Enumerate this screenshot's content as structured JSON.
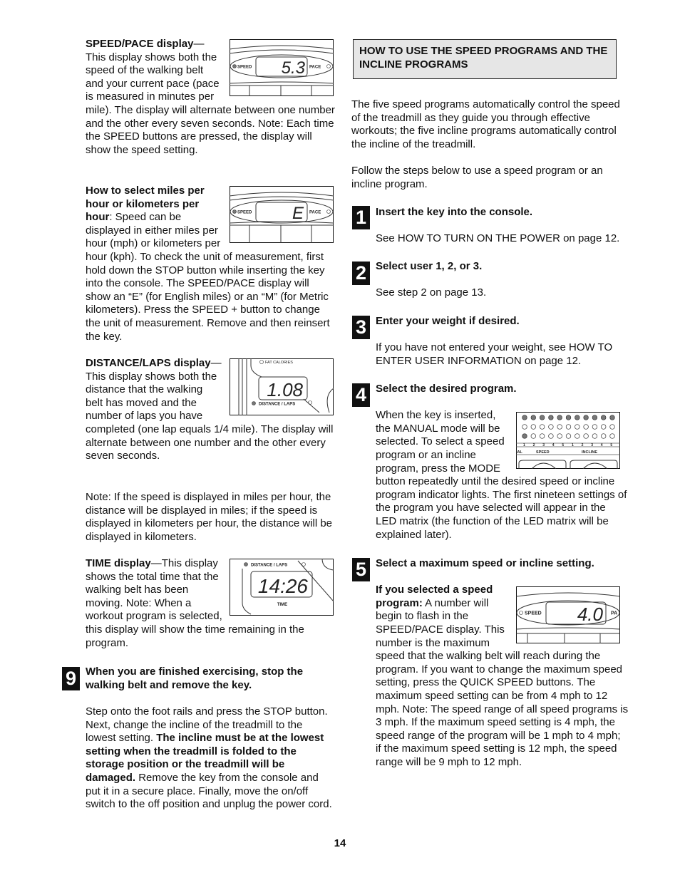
{
  "left": {
    "speed_pace": {
      "title": "SPEED/PACE display",
      "dash": "—",
      "body": "This display shows both the speed of the walking belt and your current pace (pace is measured in minutes per mile). The display will alternate between one number and the other every seven seconds. Note: Each time the SPEED buttons are pressed, the display will show the speed setting.",
      "figure": {
        "left_label": "SPEED",
        "right_label": "PACE",
        "value": "5.3"
      }
    },
    "units": {
      "title": "How to select miles per hour or kilometers per hour",
      "body": ": Speed can be displayed in either miles per hour (mph) or kilometers per hour (kph). To check the unit of measurement, first hold down the STOP button while inserting the key into the console. The SPEED/PACE display will show an “E” (for English miles) or an “M” (for Metric kilometers). Press the SPEED + button to change the unit of measurement. Remove and then reinsert the key.",
      "figure": {
        "left_label": "SPEED",
        "right_label": "PACE",
        "value": "E"
      }
    },
    "distance": {
      "title": "DISTANCE/LAPS display",
      "dash": "—",
      "body": "This display shows both the distance that the walking belt has moved and the number of laps you have completed (one lap equals 1/4 mile). The display will alternate between one number and the other every seven seconds.",
      "figure": {
        "top_label": "FAT CALORIES",
        "bottom_label": "DISTANCE / LAPS",
        "value": "1.08"
      }
    },
    "note": "Note: If the speed is displayed in miles per hour, the distance will be displayed in miles; if the speed is displayed in kilometers per hour, the distance will be displayed in kilometers.",
    "time": {
      "title": "TIME display",
      "dash": "—",
      "body": "This display shows the total time that the walking belt has been moving. Note: When a workout program is selected, this display will show the time remaining in the program.",
      "figure": {
        "top_label": "DISTANCE / LAPS",
        "bottom_label": "TIME",
        "value": "14:26"
      }
    },
    "step9": {
      "number": "9",
      "title": "When you are finished exercising, stop the walking belt and remove the key.",
      "body_a": "Step onto the foot rails and press the STOP button. Next, change the incline of the treadmill to the lowest setting. ",
      "body_bold": "The incline must be at the lowest setting when the treadmill is folded to the storage position or the treadmill will be damaged.",
      "body_b": " Remove the key from the console and put it in a secure place. Finally, move the on/off switch to the off position and unplug the power cord."
    }
  },
  "right": {
    "heading": "HOW TO USE THE SPEED PROGRAMS AND THE INCLINE PROGRAMS",
    "intro": "The five speed programs automatically control the speed of the treadmill as they guide you through effective workouts; the five incline programs automatically control the incline of the treadmill.",
    "follow": "Follow the steps below to use a speed program or an incline program.",
    "steps": [
      {
        "number": "1",
        "title": "Insert the key into the console.",
        "body": "See HOW TO TURN ON THE POWER on page 12."
      },
      {
        "number": "2",
        "title": "Select user 1, 2, or 3.",
        "body": "See step 2 on page 13."
      },
      {
        "number": "3",
        "title": "Enter your weight if desired.",
        "body": "If you have not entered your weight, see HOW TO ENTER USER INFORMATION on page 12."
      },
      {
        "number": "4",
        "title": "Select the desired program.",
        "body": "When the key is inserted, the MANUAL mode will be selected. To select a speed program or an incline program, press the MODE button repeatedly until the desired speed or incline program indicator lights. The first nineteen settings of the program you have selected will appear in the LED matrix (the function of the LED matrix will be explained later)."
      },
      {
        "number": "5",
        "title": "Select a maximum speed or incline setting.",
        "sub_bold": "If you selected a speed program:",
        "body": " A number will begin to flash in the SPEED/PACE display. This number is the maximum speed that the walking belt will reach during the program. If you want to change the maximum speed setting, press the QUICK SPEED buttons. The maximum speed setting can be from 4 mph to 12 mph. Note: The speed range of all speed programs is 3 mph. If the maximum speed setting is 4 mph, the speed range of the program will be 1 mph to 4 mph; if the maximum speed setting is 12 mph, the speed range will be 9 mph to 12 mph."
      }
    ],
    "led_figure": {
      "numbers": [
        "1",
        "2",
        "3",
        "4",
        "5",
        "1",
        "2",
        "3",
        "4",
        "5"
      ],
      "left_label": "IAL",
      "speed_label": "SPEED",
      "incline_label": "INCLINE"
    },
    "speed_figure": {
      "left_label": "SPEED",
      "right_label": "PA",
      "value": "4.0"
    }
  },
  "page_number": "14"
}
